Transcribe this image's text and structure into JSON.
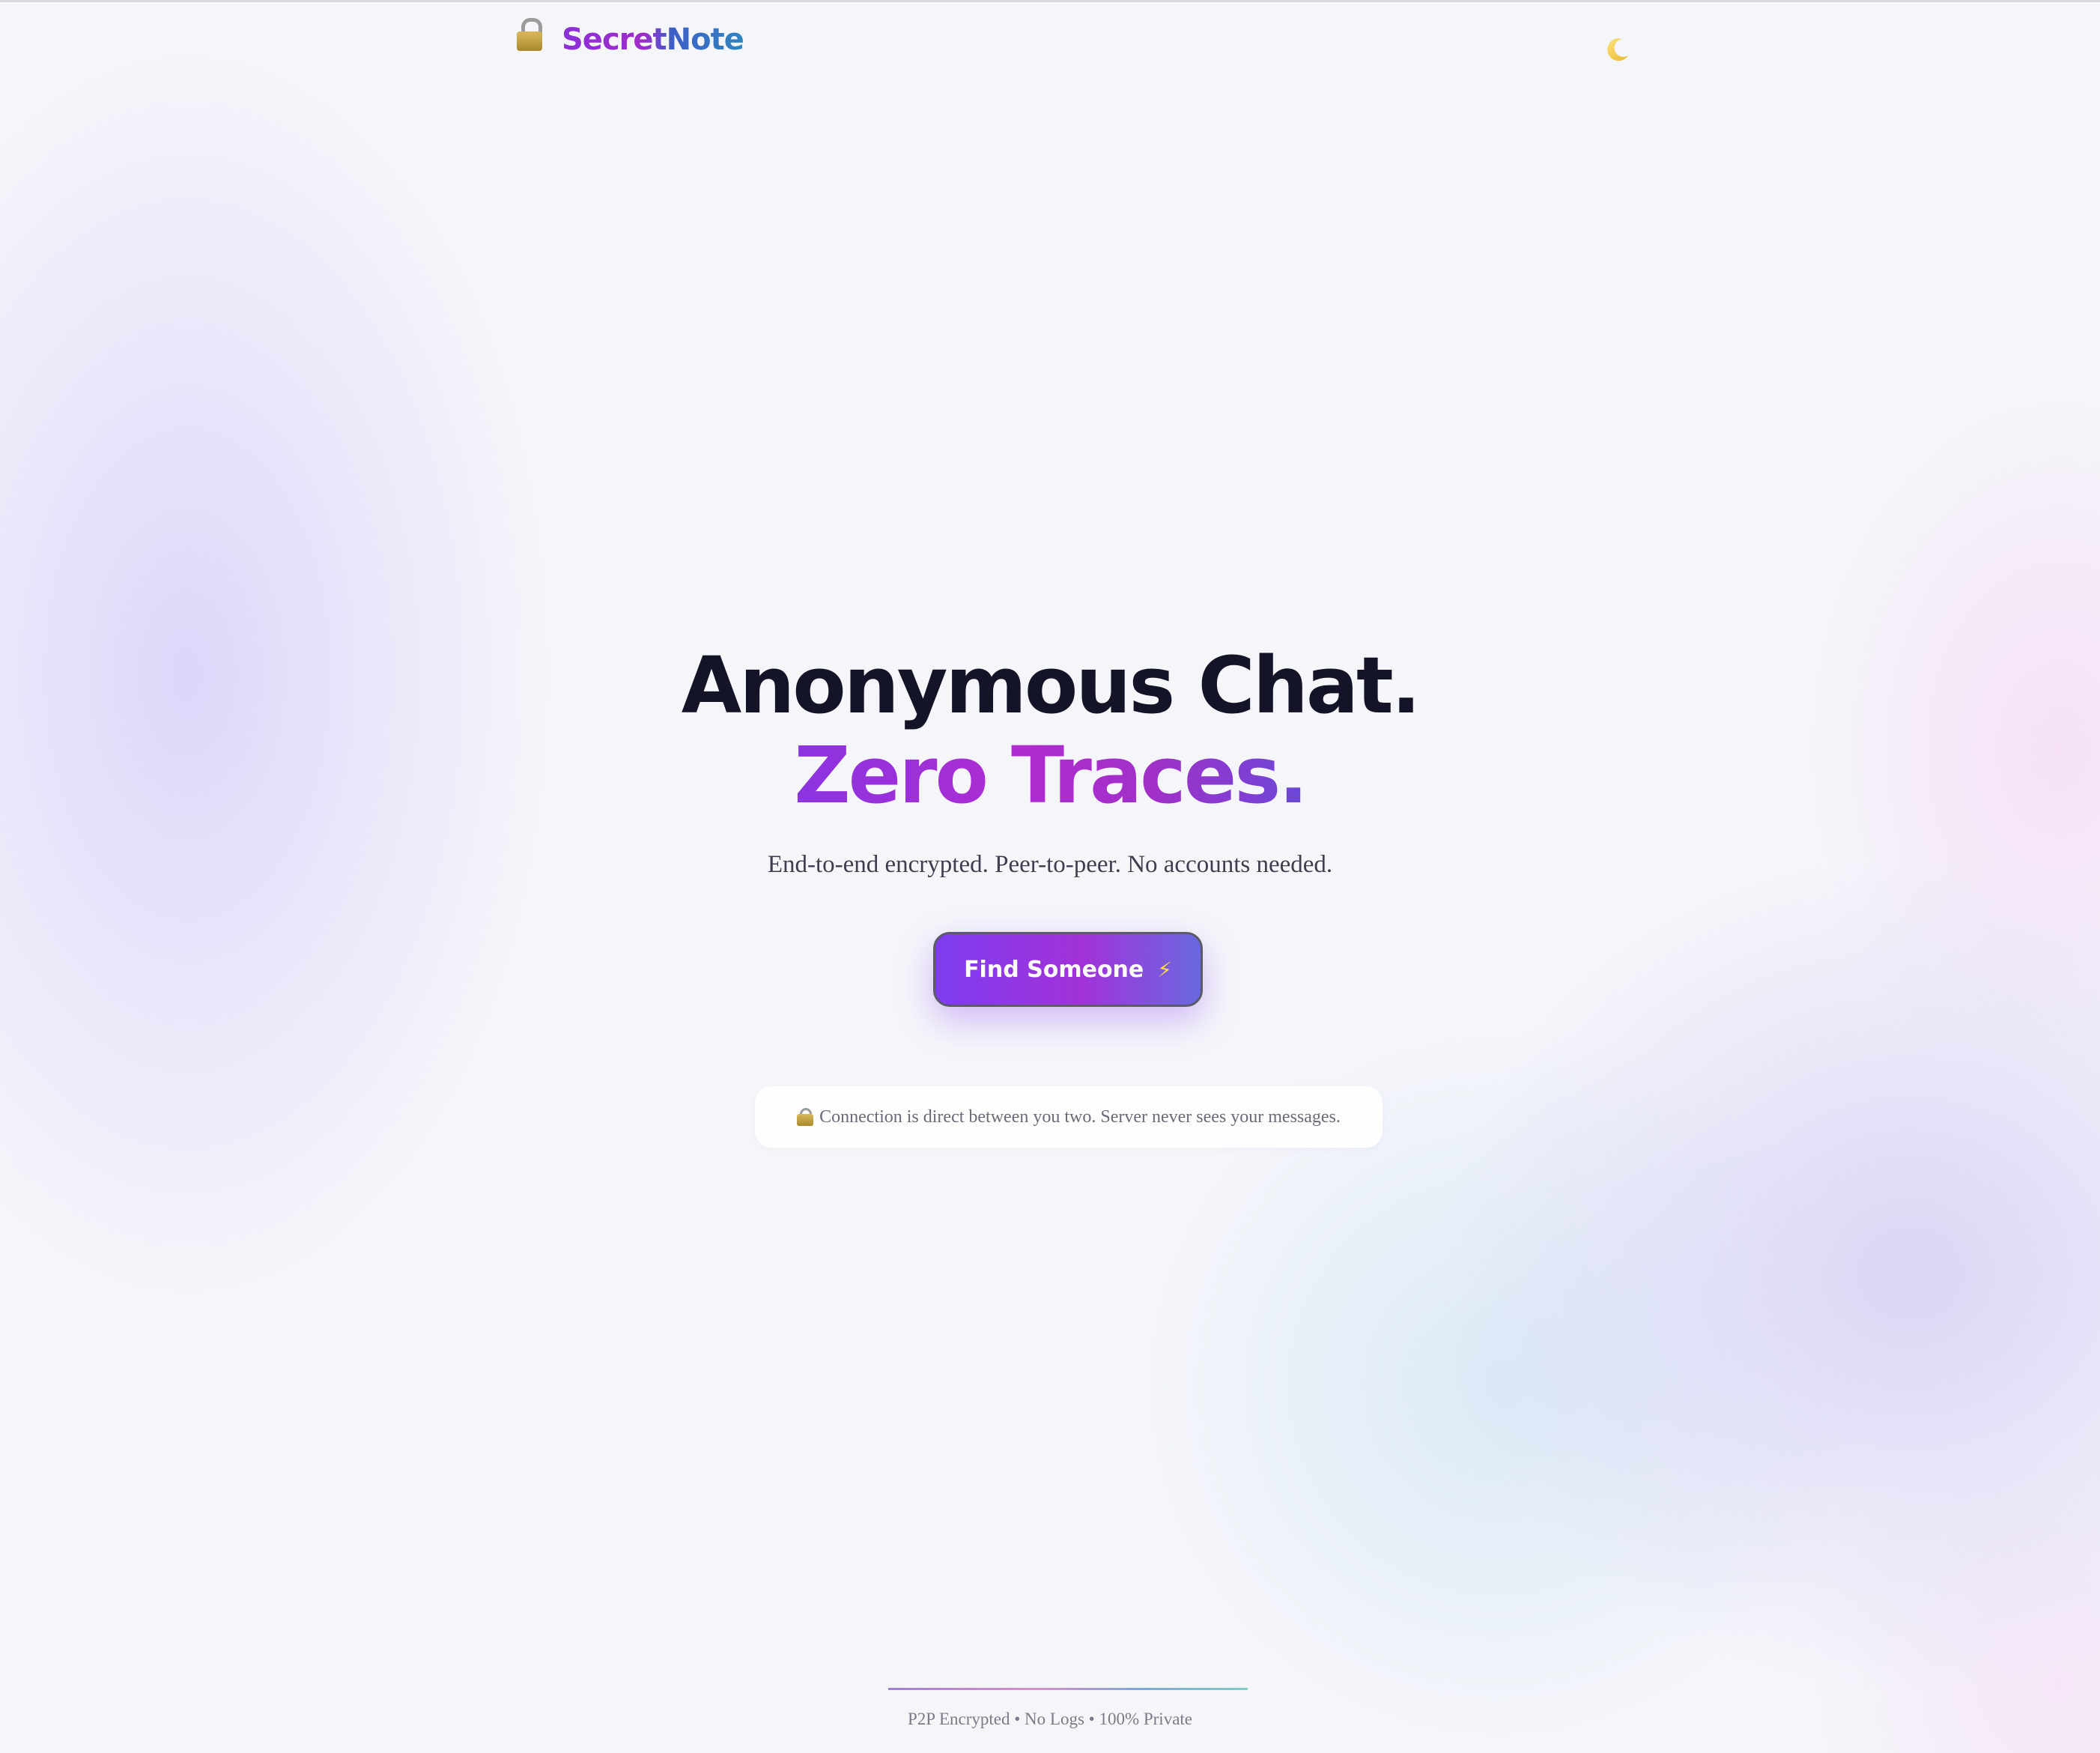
{
  "header": {
    "brand": "SecretNote",
    "logo_icon": "lock-icon",
    "theme_toggle_icon": "moon-icon"
  },
  "hero": {
    "title_line1": "Anonymous Chat.",
    "title_line2": "Zero Traces.",
    "subtitle": "End-to-end encrypted. Peer-to-peer. No accounts needed."
  },
  "cta": {
    "label": "Find Someone",
    "icon": "lightning-icon"
  },
  "notice": {
    "icon": "lock-with-key-icon",
    "text": "Connection is direct between you two. Server never sees your messages."
  },
  "footer": {
    "text": "P2P Encrypted • No Logs • 100% Private"
  },
  "colors": {
    "accent_purple": "#8a34e0",
    "accent_magenta": "#b02cd0",
    "accent_blue": "#2f86c0",
    "title_dark": "#141428",
    "background": "#f5f6fa"
  }
}
